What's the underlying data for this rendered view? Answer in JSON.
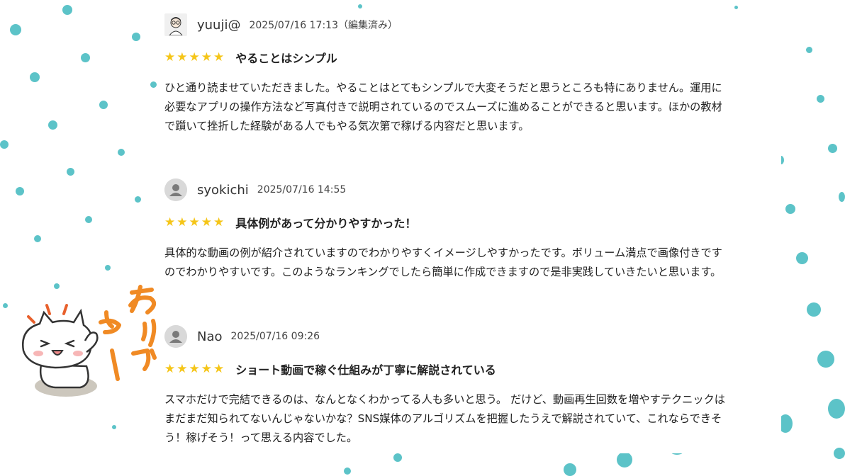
{
  "reviews": [
    {
      "user": "yuuji@",
      "date": "2025/07/16 17:13（編集済み）",
      "stars": "★★★★★",
      "title": "やることはシンプル",
      "body": "ひと通り読ませていただきました。やることはとてもシンプルで大変そうだと思うところも特にありません。運用に必要なアプリの操作方法など写真付きで説明されているのでスムーズに進めることができると思います。ほかの教材で躓いて挫折した経験がある人でもやる気次第で稼げる内容だと思います。"
    },
    {
      "user": "syokichi",
      "date": "2025/07/16 14:55",
      "stars": "★★★★★",
      "title": "具体例があって分かりやすかった！",
      "body": "具体的な動画の例が紹介されていますのでわかりやすくイメージしやすかったです。ボリューム満点で画像付きですのでわかりやすいです。このようなランキングでしたら簡単に作成できますので是非実践していきたいと思います。"
    },
    {
      "user": "Nao",
      "date": "2025/07/16 09:26",
      "stars": "★★★★★",
      "title": "ショート動画で稼ぐ仕組みが丁寧に解説されている",
      "body": "スマホだけで完結できるのは、なんとなくわかってる人も多いと思う。 だけど、動画再生回数を増やすテクニックはまだまだ知られてないんじゃないかな？SNS媒体のアルゴリズムを把握したうえで解説されていて、これならできそう！稼げそう！って思える内容でした。"
    }
  ],
  "sticker": {
    "text": "ありがとー"
  },
  "colors": {
    "dot": "#5cc3c8",
    "star": "#f5c518",
    "sticker_text": "#f08a24"
  }
}
